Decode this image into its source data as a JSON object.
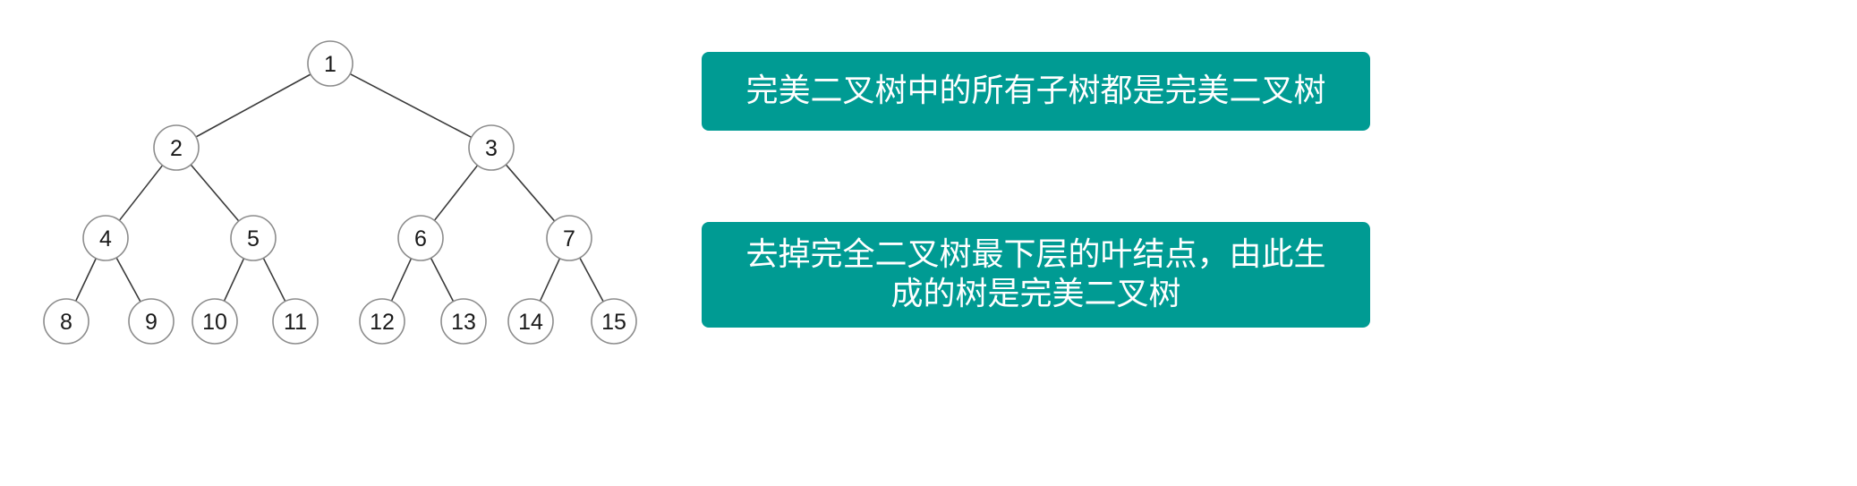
{
  "tree": {
    "nodes": [
      {
        "id": 1,
        "label": "1"
      },
      {
        "id": 2,
        "label": "2"
      },
      {
        "id": 3,
        "label": "3"
      },
      {
        "id": 4,
        "label": "4"
      },
      {
        "id": 5,
        "label": "5"
      },
      {
        "id": 6,
        "label": "6"
      },
      {
        "id": 7,
        "label": "7"
      },
      {
        "id": 8,
        "label": "8"
      },
      {
        "id": 9,
        "label": "9"
      },
      {
        "id": 10,
        "label": "10"
      },
      {
        "id": 11,
        "label": "11"
      },
      {
        "id": 12,
        "label": "12"
      },
      {
        "id": 13,
        "label": "13"
      },
      {
        "id": 14,
        "label": "14"
      },
      {
        "id": 15,
        "label": "15"
      }
    ],
    "edges": [
      [
        1,
        2
      ],
      [
        1,
        3
      ],
      [
        2,
        4
      ],
      [
        2,
        5
      ],
      [
        3,
        6
      ],
      [
        3,
        7
      ],
      [
        4,
        8
      ],
      [
        4,
        9
      ],
      [
        5,
        10
      ],
      [
        5,
        11
      ],
      [
        6,
        12
      ],
      [
        6,
        13
      ],
      [
        7,
        14
      ],
      [
        7,
        15
      ]
    ],
    "colors": {
      "node_border": "#8c8c8c",
      "edge": "#3a3a3a"
    }
  },
  "notes": [
    {
      "lines": [
        "完美二叉树中的所有子树都是完美二叉树"
      ]
    },
    {
      "lines": [
        "去掉完全二叉树最下层的叶结点，由此生",
        "成的树是完美二叉树"
      ]
    }
  ],
  "colors": {
    "note_background": "#009b93",
    "note_text": "#ffffff"
  }
}
